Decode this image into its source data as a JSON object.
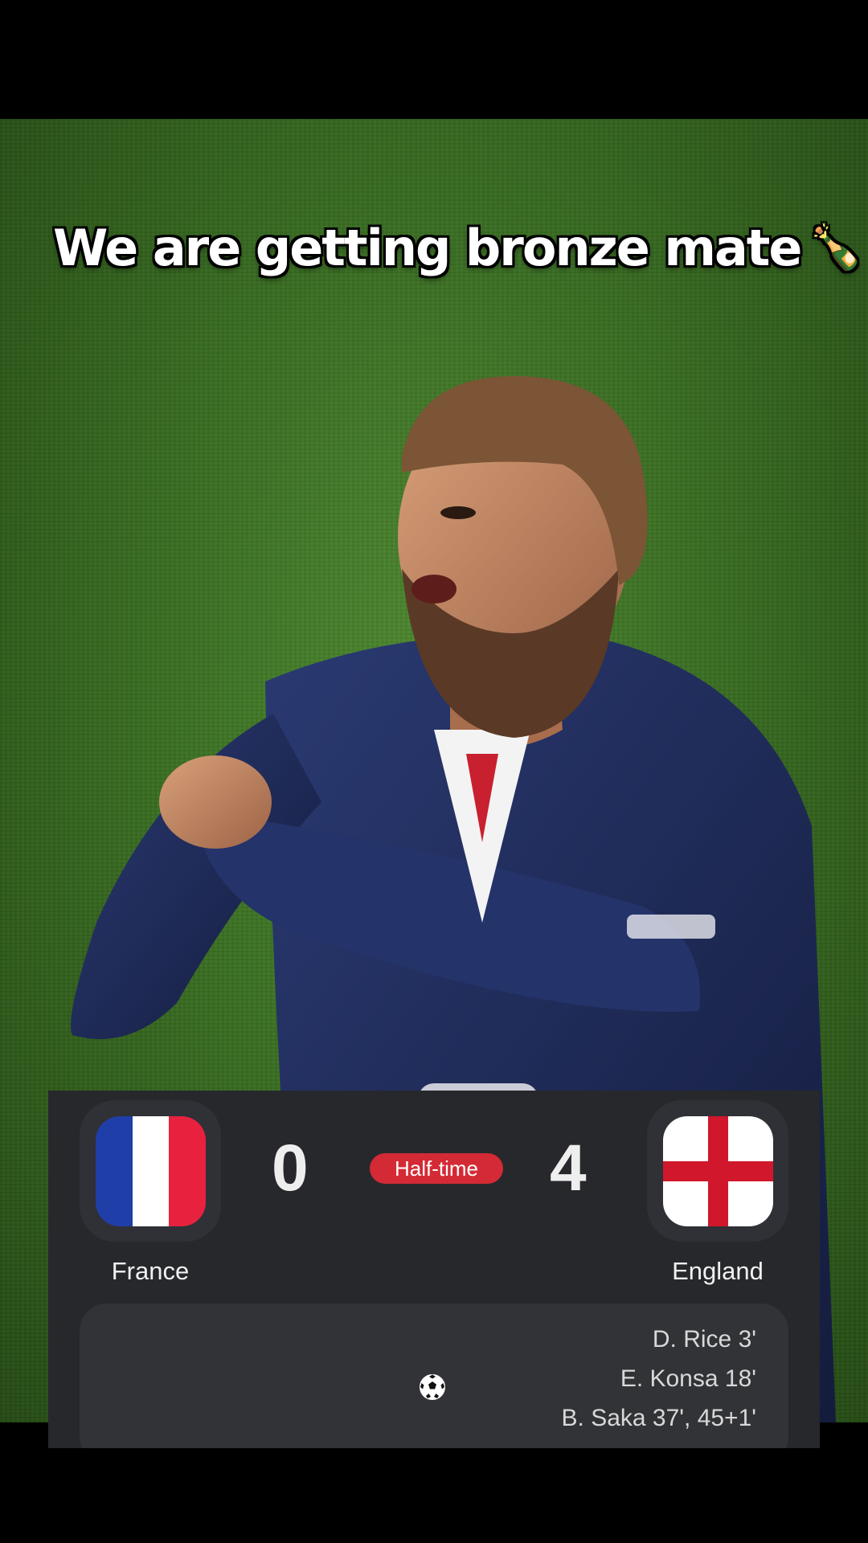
{
  "caption": {
    "text": "We are getting bronze mate",
    "emoji": "🍾🥉"
  },
  "match": {
    "status": "Half-time",
    "home": {
      "name": "France",
      "score": "0",
      "flag_icon": "france-flag-icon"
    },
    "away": {
      "name": "England",
      "score": "4",
      "flag_icon": "england-flag-icon"
    },
    "away_scorers": [
      "D. Rice 3'",
      "E. Konsa 18'",
      "B. Saka 37', 45+1'"
    ],
    "goal_icon": "soccer-ball-icon"
  },
  "colors": {
    "card_bg": "#27282c",
    "status_bg": "#d42a35",
    "pitch": "#3f7a25",
    "jersey": "#1e2a55"
  }
}
